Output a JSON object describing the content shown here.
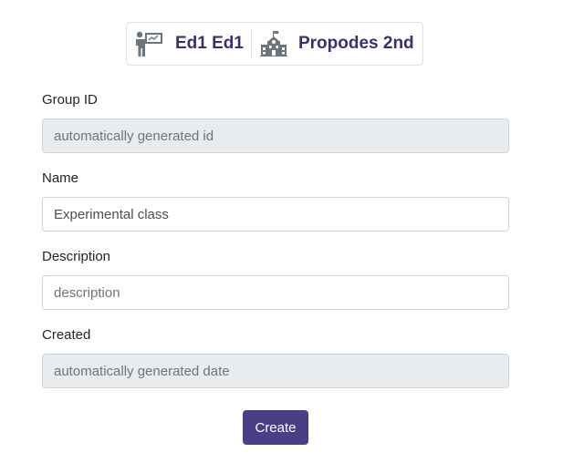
{
  "header": {
    "teacher_icon": "teacher-presentation-icon",
    "teacher_name": "Ed1 Ed1",
    "school_icon": "school-building-icon",
    "school_name": "Propodes 2nd"
  },
  "form": {
    "group_id": {
      "label": "Group ID",
      "value": "automatically generated id"
    },
    "name": {
      "label": "Name",
      "value": "Experimental class"
    },
    "description": {
      "label": "Description",
      "placeholder": "description"
    },
    "created": {
      "label": "Created",
      "value": "automatically generated date"
    }
  },
  "actions": {
    "create_label": "Create"
  },
  "colors": {
    "accent": "#4a3f87",
    "header_text": "#3b2f6e",
    "readonly_bg": "#e9ecef",
    "icon_gray": "#6c757d"
  }
}
